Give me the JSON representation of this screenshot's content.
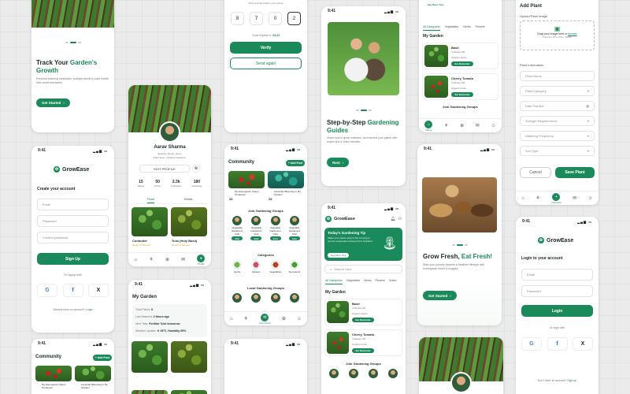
{
  "status_time": "9:41",
  "onboard1": {
    "title_a": "Track Your ",
    "title_b": "Garden's Growth",
    "desc": "Personal watering schedules, sunlight needs & plant health with smart reminders.",
    "cta": "Get Started"
  },
  "otp": {
    "digits": [
      "8",
      "7",
      "0",
      "2"
    ],
    "resend_note": "Code expires in:",
    "timer": "03:22",
    "verify": "Verify",
    "send_again": "Send again",
    "top_note": "We'll sent the code in your phone"
  },
  "onboard2": {
    "title_a": "Step-by-Step ",
    "title_b": "Gardening Guides",
    "desc": "Learn how to grow, maintain, and harvest your plants with expert tips & video tutorials.",
    "cta": "Next"
  },
  "mygarden_top": {
    "tip_btn": "See More Tips",
    "tabs": [
      "All Categories",
      "Vegetables",
      "Herbs",
      "Flowers"
    ],
    "section": "My Garden",
    "plants": [
      {
        "name": "Basil",
        "age": "3 Weeks Old",
        "tag": "Organic Herbs",
        "btn": "Set Reminder"
      },
      {
        "name": "Cherry Tomato",
        "age": "4 Weeks Old",
        "tag": "Organic Fruits",
        "btn": "Set Reminder"
      }
    ],
    "groups": "Join Gardening Groups",
    "nav_home": "Home"
  },
  "addplant": {
    "title": "Add Plant",
    "upload_label": "Upload Plant Image",
    "drag": "Drag your image here or",
    "browse": "browse",
    "supports": "Supports JPG, PNG, WEBP",
    "info": "Plant Information",
    "fields": [
      "Plant Name",
      "Plant Category",
      "Date Planted",
      "Sunlight Requirements",
      "Watering Frequency",
      "Soil Type"
    ],
    "cancel": "Cancel",
    "save": "Save Plant",
    "nav_add": "Add plant"
  },
  "signup": {
    "brand": "GrowEase",
    "heading": "Create your account",
    "fields": [
      "Email",
      "Password",
      "Confirm password"
    ],
    "cta": "Sign Up",
    "or": "Or signup with",
    "have": "Already have an account?",
    "login": "Login"
  },
  "profile": {
    "name": "Aarav Sharma",
    "handle": "@aarav_thumb_green",
    "meta": "Plant lover • Organic Gardener",
    "edit": "EDIT PROFILE",
    "stats": [
      {
        "v": "15",
        "l": "Plants"
      },
      {
        "v": "50",
        "l": "Posts"
      },
      {
        "v": "2.3k",
        "l": "Followers"
      },
      {
        "v": "180",
        "l": "Following"
      }
    ],
    "tabs": [
      "Plants",
      "Details"
    ],
    "items": [
      {
        "name": "Coriander",
        "sub": "Ready to harvest"
      },
      {
        "name": "Tulsi (Holy Basil)",
        "sub": "Ready to harvest"
      }
    ],
    "nav_label": "Profile"
  },
  "community_mid": {
    "title": "Community",
    "add": "+ Add Post",
    "posts": [
      {
        "t": "My Homegrown Cherry Tomatoes!",
        "c": "25"
      },
      {
        "t": "Lavender Blooming in My Garden!",
        "c": "25"
      }
    ],
    "groups_title": "Join Gardening Groups",
    "group_items": [
      "Vegetable Gardeners Club",
      "Vegetable Gardeners Club",
      "Vegetable Gardeners Club",
      "Vegetable Gardeners Club"
    ],
    "join": "Join",
    "cats_title": "Categories",
    "cats": [
      "Herbs",
      "Flowers",
      "Vegetables",
      "Succulents"
    ],
    "local_title": "Local Gardening Groups",
    "nav_label": "Community"
  },
  "home": {
    "brand": "GrowEase",
    "tip_title": "Today's Gardening Tip",
    "tip_desc": "Water your plants early in the morning to prevent evaporation & keep them hydrated.",
    "tip_btn": "See More Tips",
    "search": "Search Here",
    "tabs": [
      "All Categories",
      "Vegetables",
      "Herbs",
      "Flowers",
      "Green"
    ],
    "section": "My Garden",
    "plants": [
      {
        "name": "Basil",
        "age": "3 Weeks Old",
        "tag": "Organic Herbs",
        "btn": "Set Reminder"
      },
      {
        "name": "Cherry Tomato",
        "age": "4 Weeks Old",
        "tag": "Organic Fruits",
        "btn": "Set Reminder"
      }
    ],
    "groups": "Join Gardening Groups"
  },
  "onboard3": {
    "title_a": "Grow Fresh, ",
    "title_b": "Eat Fresh!",
    "desc": "Start your journey towards a healthier lifestyle with homegrown herbs & veggies.",
    "cta": "Get Started"
  },
  "login": {
    "brand": "GrowEase",
    "heading": "Login to your account",
    "fields": [
      "Email",
      "Password"
    ],
    "cta": "Login",
    "or": "Or login with",
    "no_acc": "Don't have an account?",
    "signup": "Sign up"
  },
  "mygarden2": {
    "title": "My Garden",
    "rows": [
      {
        "k": "Total Plants:",
        "v": "8"
      },
      {
        "k": "Last Watered:",
        "v": "2 Hours ago"
      },
      {
        "k": "Next Task:",
        "v": "Fertilize Tulsi tomorrow"
      },
      {
        "k": "Weather Update:",
        "v": "☀ 28°C, Humidity 65%"
      }
    ]
  },
  "community_bot": {
    "title": "Community",
    "add": "+ Add Post",
    "posts": [
      {
        "t": "My Homegrown Cherry Tomatoes!",
        "c": "25"
      },
      {
        "t": "Lavender Blooming in My Garden!",
        "c": "25"
      }
    ]
  },
  "colors": {
    "accent": "#1b8a5a"
  }
}
